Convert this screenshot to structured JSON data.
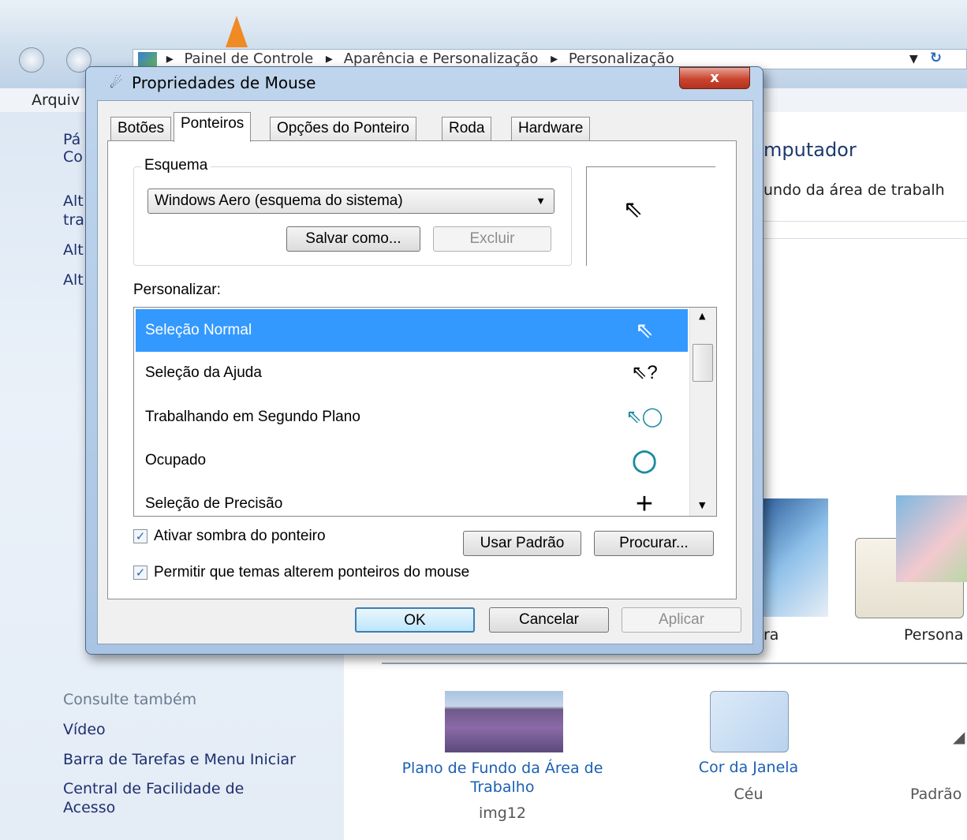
{
  "explorer": {
    "address": [
      "Painel de Controle",
      "Aparência e Personalização",
      "Personalização"
    ],
    "menu_first": "Arquiv",
    "sidebar_fragments": [
      "Pá",
      "Co",
      "Alt",
      "tra",
      "Alt",
      "Alt"
    ],
    "main_heading_fragment": "mputador",
    "main_sub_fragment": "undo da área de trabalh",
    "theme_label_fragment": "ra",
    "theme_label_2": "Persona",
    "see_also": {
      "heading": "Consulte também",
      "links": [
        "Vídeo",
        "Barra de Tarefas e Menu Iniciar",
        "Central de Facilidade de Acesso"
      ]
    },
    "bottom_items": [
      {
        "title": "Plano de Fundo da Área de Trabalho",
        "sub": "img12"
      },
      {
        "title": "Cor da Janela",
        "sub": "Céu"
      },
      {
        "title": "",
        "sub": "Padrão"
      }
    ]
  },
  "dialog": {
    "title": "Propriedades de Mouse",
    "close_glyph": "x",
    "tabs": [
      "Botões",
      "Ponteiros",
      "Opções do Ponteiro",
      "Roda",
      "Hardware"
    ],
    "active_tab": "Ponteiros",
    "scheme_group": "Esquema",
    "scheme_value": "Windows Aero (esquema do sistema)",
    "save_as": "Salvar como...",
    "delete": "Excluir",
    "customize_label": "Personalizar:",
    "pointers": [
      {
        "name": "Seleção Normal",
        "icon": "arrow-cursor-icon",
        "glyph": "⇖",
        "selected": true
      },
      {
        "name": "Seleção da Ajuda",
        "icon": "help-cursor-icon",
        "glyph": "⇖?",
        "selected": false
      },
      {
        "name": "Trabalhando em Segundo Plano",
        "icon": "working-cursor-icon",
        "glyph": "⇖◯",
        "selected": false
      },
      {
        "name": "Ocupado",
        "icon": "busy-cursor-icon",
        "glyph": "◯",
        "selected": false
      },
      {
        "name": "Seleção de Precisão",
        "icon": "crosshair-cursor-icon",
        "glyph": "+",
        "selected": false
      }
    ],
    "enable_shadow": "Ativar sombra do ponteiro",
    "allow_themes": "Permitir que temas alterem ponteiros do mouse",
    "use_default": "Usar Padrão",
    "browse": "Procurar...",
    "ok": "OK",
    "cancel": "Cancelar",
    "apply": "Aplicar"
  }
}
